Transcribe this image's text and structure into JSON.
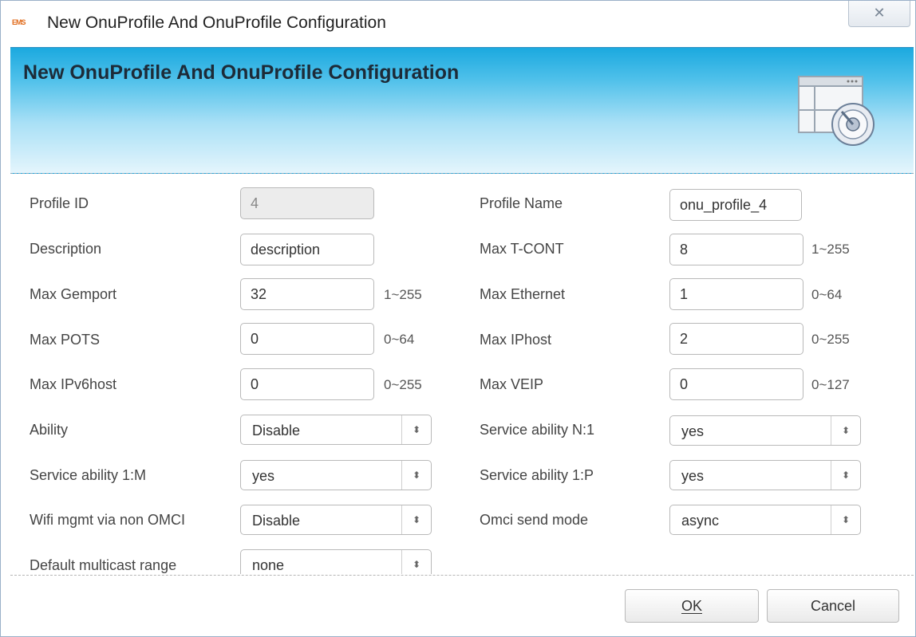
{
  "window": {
    "title": "New OnuProfile And OnuProfile Configuration",
    "app_icon_text": "EMS",
    "close_symbol": "✕"
  },
  "banner": {
    "title": "New OnuProfile And OnuProfile Configuration",
    "icon": "window-settings-icon"
  },
  "form": {
    "profile_id": {
      "label": "Profile ID",
      "value": "4"
    },
    "profile_name": {
      "label": "Profile Name",
      "value": "onu_profile_4"
    },
    "description": {
      "label": "Description",
      "value": "description"
    },
    "max_tcont": {
      "label": "Max T-CONT",
      "value": "8",
      "hint": "1~255"
    },
    "max_gemport": {
      "label": "Max Gemport",
      "value": "32",
      "hint": "1~255"
    },
    "max_ethernet": {
      "label": "Max Ethernet",
      "value": "1",
      "hint": "0~64"
    },
    "max_pots": {
      "label": "Max POTS",
      "value": "0",
      "hint": "0~64"
    },
    "max_iphost": {
      "label": "Max IPhost",
      "value": "2",
      "hint": "0~255"
    },
    "max_ipv6host": {
      "label": "Max IPv6host",
      "value": "0",
      "hint": "0~255"
    },
    "max_veip": {
      "label": "Max VEIP",
      "value": "0",
      "hint": "0~127"
    },
    "ability": {
      "label": "Ability",
      "value": "Disable"
    },
    "service_ability_n1": {
      "label": "Service ability N:1",
      "value": "yes"
    },
    "service_ability_1m": {
      "label": "Service ability 1:M",
      "value": "yes"
    },
    "service_ability_1p": {
      "label": "Service ability 1:P",
      "value": "yes"
    },
    "wifi_mgmt": {
      "label": "Wifi mgmt via non OMCI",
      "value": "Disable"
    },
    "omci_send_mode": {
      "label": "Omci send mode",
      "value": "async"
    },
    "default_multicast_range": {
      "label": "Default multicast range",
      "value": "none"
    }
  },
  "buttons": {
    "ok": "OK",
    "cancel": "Cancel"
  }
}
